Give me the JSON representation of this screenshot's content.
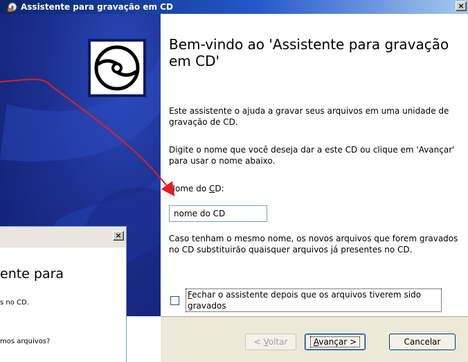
{
  "window": {
    "title": "Assistente para gravação em CD",
    "close_label": "×"
  },
  "wizard": {
    "heading": "Bem-vindo ao 'Assistente para gravação em CD'",
    "intro": "Este assistente o ajuda a gravar seus arquivos em uma unidade de gravação de CD.",
    "instructions": "Digite o nome que você deseja dar a este CD ou clique em 'Avançar' para usar o nome abaixo.",
    "cd_name_label_pre": "Nome do ",
    "cd_name_label_key": "C",
    "cd_name_label_post": "D:",
    "cd_name_value": "nome do CD",
    "note": "Caso tenham o mesmo nome, os novos arquivos que forem gravados no CD substituirão quaisquer arquivos já presentes no CD.",
    "close_checkbox_key": "F",
    "close_checkbox_rest": "echar o assistente depois que os arquivos tiverem sido gravados",
    "close_checkbox_checked": false
  },
  "buttons": {
    "back_pre": "< ",
    "back_key": "V",
    "back_rest": "oltar",
    "next_key": "A",
    "next_rest": "vançar >",
    "cancel": "Cancelar"
  },
  "second_window": {
    "close_label": "×",
    "heading_fragment": "ente para",
    "line1_fragment": "s no CD.",
    "line2_fragment": "mos arquivos?"
  },
  "icons": {
    "app": "cd-writer-icon",
    "cd": "cd-disc-icon"
  },
  "colors": {
    "titlebar": "#0a246a",
    "banner": "#1b2f8f",
    "arrow": "#e02020"
  }
}
